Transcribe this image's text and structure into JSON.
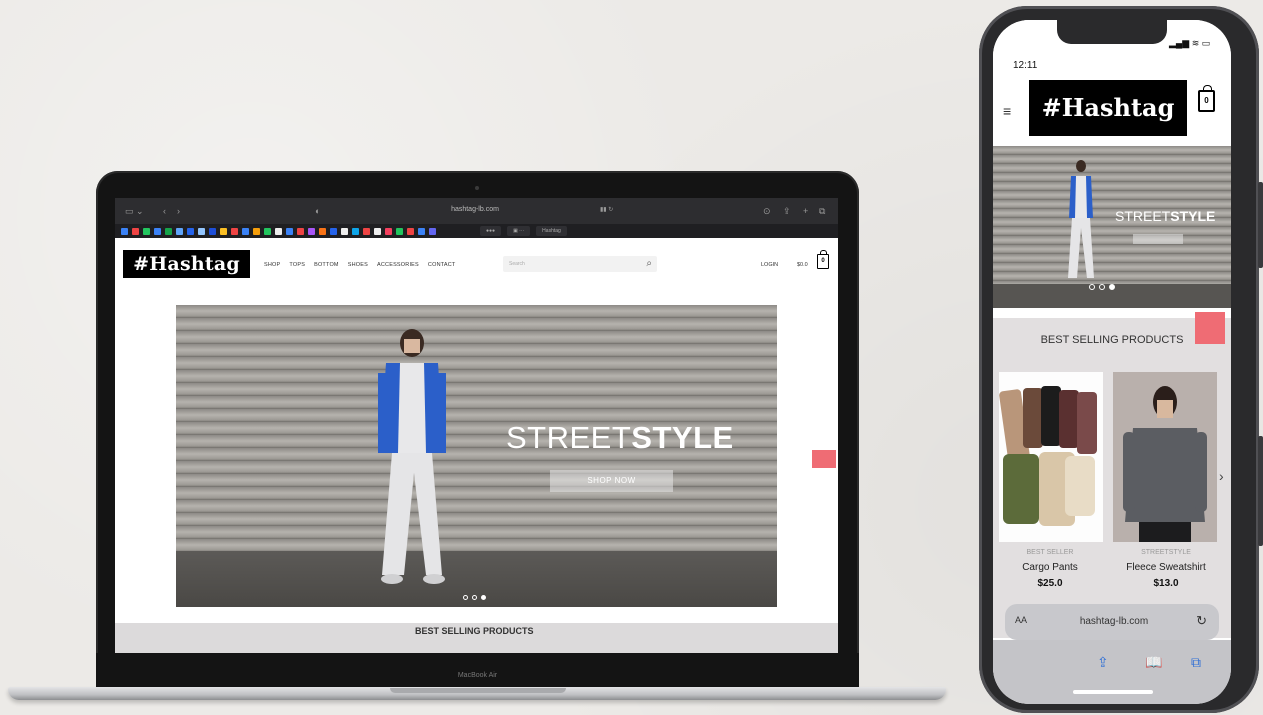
{
  "colors": {
    "logo_bg": "#000000",
    "accent_pink": "#ef6c74",
    "icon_blue": "#2f6fd6"
  },
  "laptop": {
    "browser": {
      "url": "hashtag-lb.com",
      "tab_label": "Hashtag"
    },
    "brand_label": "MacBook Air",
    "site": {
      "logo": "#Hashtag",
      "nav": [
        "SHOP",
        "TOPS",
        "BOTTOM",
        "SHOES",
        "ACCESSORIES",
        "CONTACT"
      ],
      "search_placeholder": "Search",
      "login": "LOGIN",
      "cart_total": "$0.0",
      "cart_count": "0",
      "hero": {
        "title_light": "STREET",
        "title_bold": "STYLE",
        "button": "SHOP NOW"
      },
      "section_title": "BEST SELLING PRODUCTS"
    }
  },
  "phone": {
    "time": "12:11",
    "logo": "#Hashtag",
    "cart_count": "0",
    "hero": {
      "title_light": "STREET",
      "title_bold": "STYLE"
    },
    "section_title": "BEST SELLING PRODUCTS",
    "products": [
      {
        "category": "BEST SELLER",
        "name": "Cargo Pants",
        "price": "$25.0"
      },
      {
        "category": "STREETSTYLE",
        "name": "Fleece Sweatshirt",
        "price": "$13.0"
      }
    ],
    "url": "hashtag-lb.com",
    "aa": "AA"
  }
}
